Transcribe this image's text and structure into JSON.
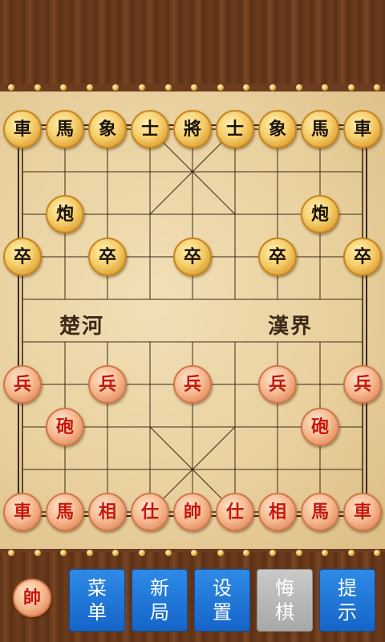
{
  "board": {
    "river_left": "楚河",
    "river_right": "漢界"
  },
  "pieces": [
    {
      "label": "車",
      "side": "black",
      "col": 0,
      "row": 0
    },
    {
      "label": "馬",
      "side": "black",
      "col": 1,
      "row": 0
    },
    {
      "label": "象",
      "side": "black",
      "col": 2,
      "row": 0
    },
    {
      "label": "士",
      "side": "black",
      "col": 3,
      "row": 0
    },
    {
      "label": "將",
      "side": "black",
      "col": 4,
      "row": 0
    },
    {
      "label": "士",
      "side": "black",
      "col": 5,
      "row": 0
    },
    {
      "label": "象",
      "side": "black",
      "col": 6,
      "row": 0
    },
    {
      "label": "馬",
      "side": "black",
      "col": 7,
      "row": 0
    },
    {
      "label": "車",
      "side": "black",
      "col": 8,
      "row": 0
    },
    {
      "label": "炮",
      "side": "black",
      "col": 1,
      "row": 2
    },
    {
      "label": "炮",
      "side": "black",
      "col": 7,
      "row": 2
    },
    {
      "label": "卒",
      "side": "black",
      "col": 0,
      "row": 3
    },
    {
      "label": "卒",
      "side": "black",
      "col": 2,
      "row": 3
    },
    {
      "label": "卒",
      "side": "black",
      "col": 4,
      "row": 3
    },
    {
      "label": "卒",
      "side": "black",
      "col": 6,
      "row": 3
    },
    {
      "label": "卒",
      "side": "black",
      "col": 8,
      "row": 3
    },
    {
      "label": "兵",
      "side": "red",
      "col": 0,
      "row": 6
    },
    {
      "label": "兵",
      "side": "red",
      "col": 2,
      "row": 6
    },
    {
      "label": "兵",
      "side": "red",
      "col": 4,
      "row": 6
    },
    {
      "label": "兵",
      "side": "red",
      "col": 6,
      "row": 6
    },
    {
      "label": "兵",
      "side": "red",
      "col": 8,
      "row": 6
    },
    {
      "label": "砲",
      "side": "red",
      "col": 1,
      "row": 7
    },
    {
      "label": "砲",
      "side": "red",
      "col": 7,
      "row": 7
    },
    {
      "label": "車",
      "side": "red",
      "col": 0,
      "row": 9
    },
    {
      "label": "馬",
      "side": "red",
      "col": 1,
      "row": 9
    },
    {
      "label": "相",
      "side": "red",
      "col": 2,
      "row": 9
    },
    {
      "label": "仕",
      "side": "red",
      "col": 3,
      "row": 9
    },
    {
      "label": "帥",
      "side": "red",
      "col": 4,
      "row": 9
    },
    {
      "label": "仕",
      "side": "red",
      "col": 5,
      "row": 9
    },
    {
      "label": "相",
      "side": "red",
      "col": 6,
      "row": 9
    },
    {
      "label": "馬",
      "side": "red",
      "col": 7,
      "row": 9
    },
    {
      "label": "車",
      "side": "red",
      "col": 8,
      "row": 9
    }
  ],
  "turn_indicator": {
    "label": "帥",
    "side": "red"
  },
  "controls": {
    "menu": "菜单",
    "new_game": "新局",
    "settings": "设置",
    "undo": "悔棋",
    "hint": "提示"
  },
  "colors": {
    "button_blue": "#1f78dc",
    "button_disabled": "#b8b8b8",
    "red_piece_text": "#c3180f",
    "black_piece_text": "#1a1208"
  }
}
